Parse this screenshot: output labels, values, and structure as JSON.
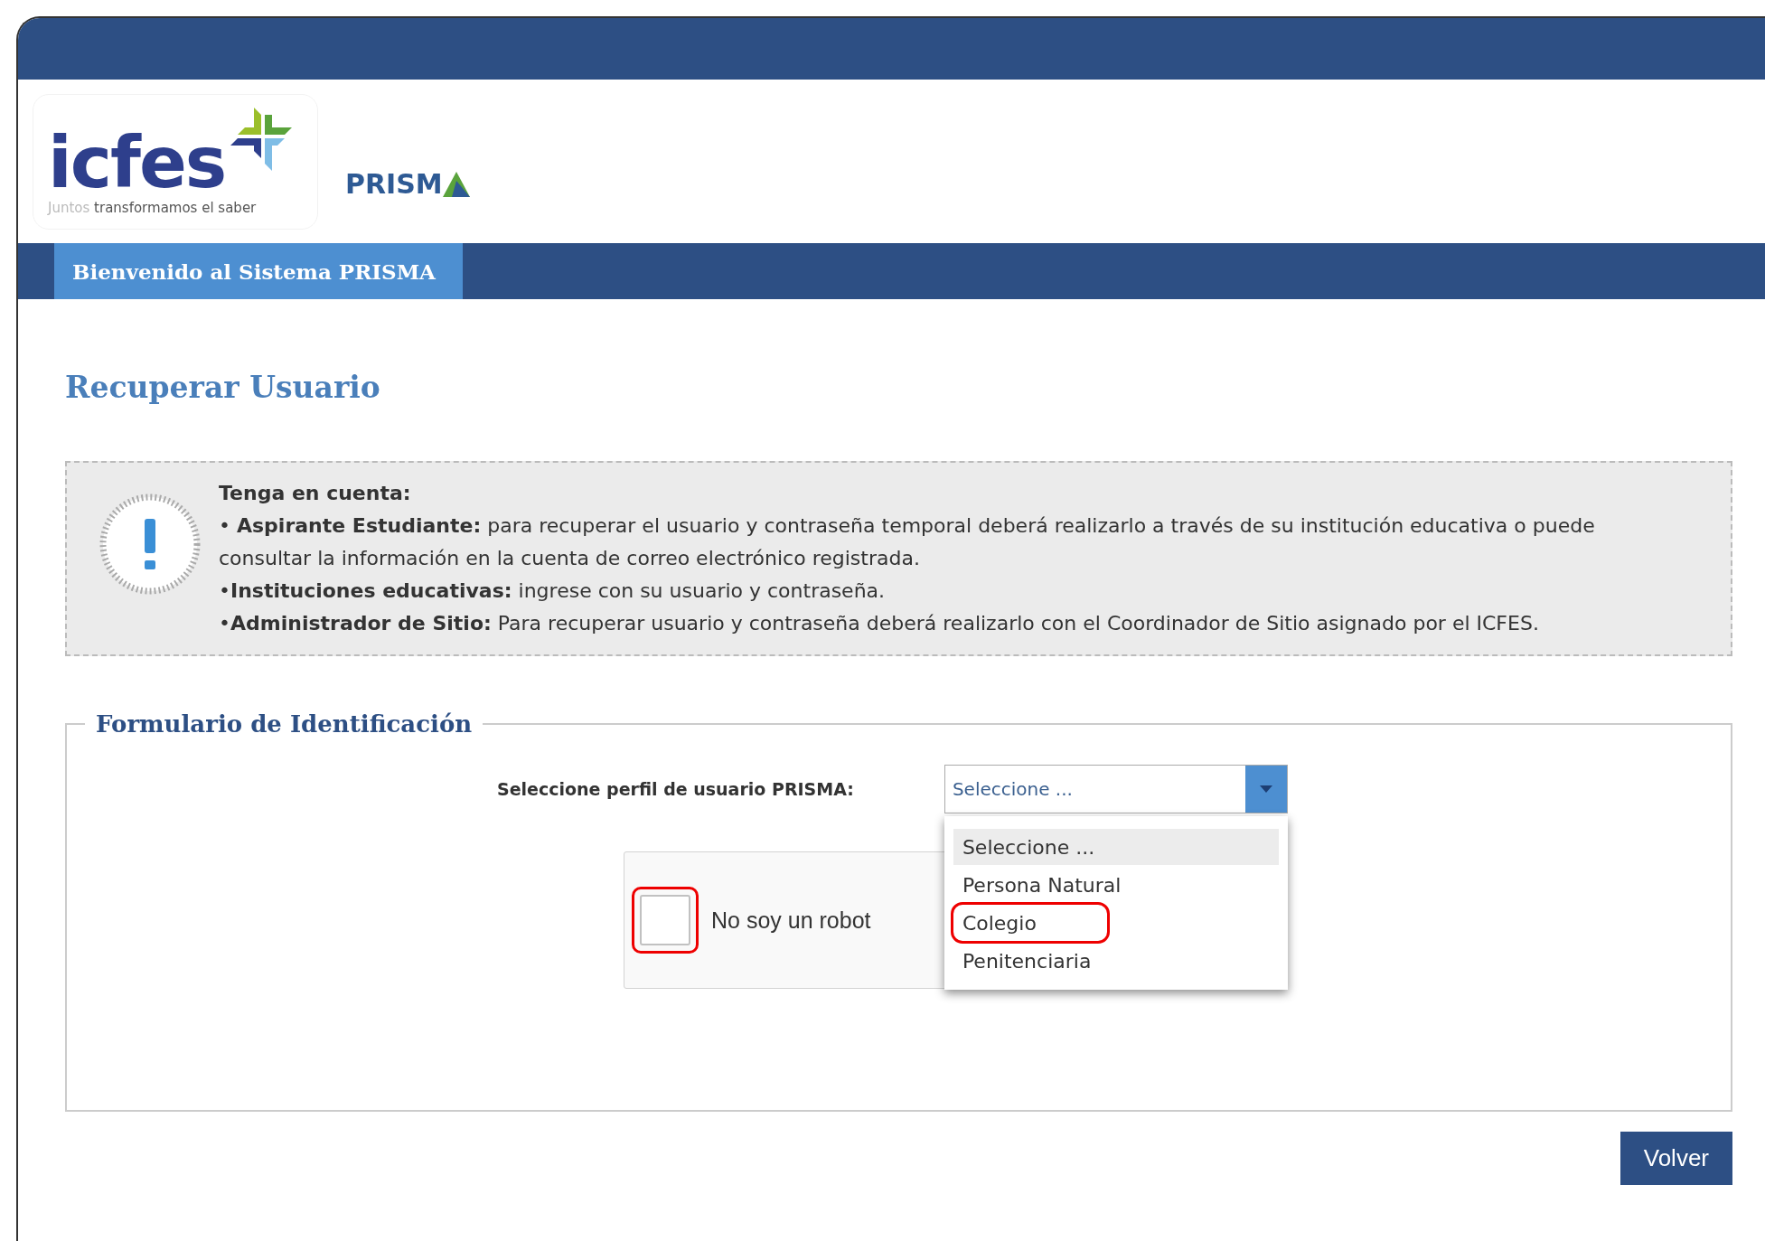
{
  "header": {
    "logo_text": "icfes",
    "tagline_light": "Juntos",
    "tagline": "transformamos el saber",
    "product": "PRISM"
  },
  "nav": {
    "tabs": [
      {
        "label": "Bienvenido al Sistema PRISMA",
        "selected": true
      }
    ]
  },
  "page_title": "Recuperar Usuario",
  "notice": {
    "heading": "Tenga en cuenta:",
    "lines": [
      "• **Aspirante Estudiante:** para recuperar el usuario y contraseña temporal deberá realizarlo a través de su institución educativa o puede consultar la información en la cuenta de correo electrónico registrada.",
      "•**Instituciones educativas:** ingrese con su usuario y contraseña.",
      "•**Administrador de Sitio:** Para recuperar usuario y contraseña deberá realizarlo con el Coordinador de Sitio asignado por el ICFES."
    ]
  },
  "form": {
    "legend": "Formulario de Identificación",
    "profile_label": "Seleccione perfil de usuario PRISMA:",
    "select_value": "Seleccione ...",
    "expanded": true,
    "options": [
      {
        "label": "Seleccione ...",
        "selected": true,
        "annotated": false
      },
      {
        "label": "Persona Natural",
        "selected": false,
        "annotated": false
      },
      {
        "label": "Colegio",
        "selected": false,
        "annotated": true
      },
      {
        "label": "Penitenciaria",
        "selected": false,
        "annotated": false
      }
    ],
    "captcha": {
      "label": "No soy un robot",
      "checked": false,
      "annotated": true
    }
  },
  "buttons": [
    {
      "label": "Volver"
    }
  ]
}
